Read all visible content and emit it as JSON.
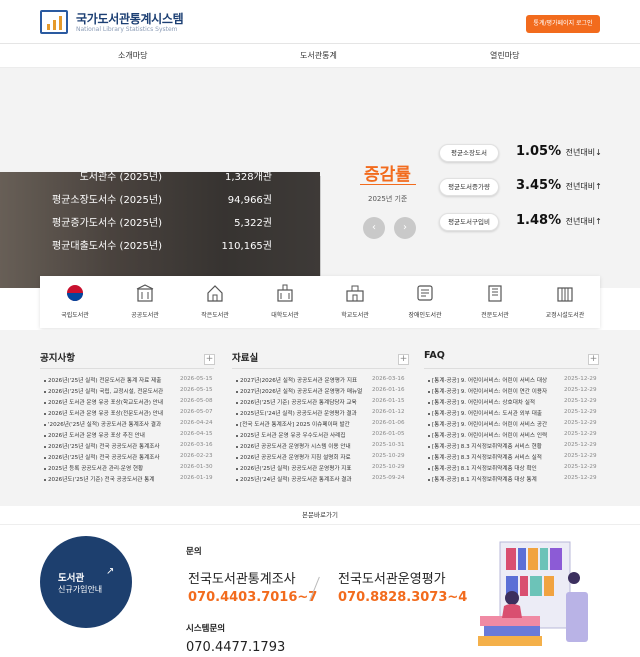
{
  "header": {
    "title": "국가도서관통계시스템",
    "subtitle": "National Library Statistics System",
    "login_button": "통계/평가페이지 로그인"
  },
  "nav": {
    "items": [
      "소개마당",
      "도서관통계",
      "열린마당"
    ]
  },
  "hero": {
    "stats": [
      {
        "label": "도서관수 (2025년)",
        "value": "1,328개관"
      },
      {
        "label": "평균소장도서수 (2025년)",
        "value": "94,966권"
      },
      {
        "label": "평균증가도서수 (2025년)",
        "value": "5,322권"
      },
      {
        "label": "평균대출도서수 (2025년)",
        "value": "110,165권"
      }
    ],
    "rate_title": "증감률",
    "rate_year": "2025년 기준",
    "prev_arrow": "‹",
    "next_arrow": "›",
    "rates": [
      {
        "label": "평균소장도서",
        "pct": "1.05%",
        "suffix": "전년대비↓"
      },
      {
        "label": "평균도서증가량",
        "pct": "3.45%",
        "suffix": "전년대비↑"
      },
      {
        "label": "평균도서구입비",
        "pct": "1.48%",
        "suffix": "전년대비↑"
      }
    ]
  },
  "libraries": [
    "국립도서관",
    "공공도서관",
    "작은도서관",
    "대학도서관",
    "학교도서관",
    "장애인도서관",
    "전문도서관",
    "교정시설도서관"
  ],
  "boards": [
    {
      "title": "공지사항",
      "posts": [
        {
          "t": "2026년('25년 실적) 전문도서관 통계 자료 제출",
          "d": "2026-05-15"
        },
        {
          "t": "2026년('25년 실적) 국립, 교정시설, 전문도서관",
          "d": "2026-05-15"
        },
        {
          "t": "2026년 도서관 운영 유공 포상(학교도서관) 안내",
          "d": "2026-05-08"
        },
        {
          "t": "2026년 도서관 운영 유공 포상(전문도서관) 안내",
          "d": "2026-05-07"
        },
        {
          "t": "'2026년('25년 실적) 공공도서관 통계조사 결과",
          "d": "2026-04-24"
        },
        {
          "t": "2026년 도서관 운영 유공 포상 추진 안내",
          "d": "2026-04-15"
        },
        {
          "t": "2026년('25년 실적) 전국 공공도서관 통계조사",
          "d": "2026-03-16"
        },
        {
          "t": "2026년('25년 실적) 전국 공공도서관 통계조사",
          "d": "2026-02-23"
        },
        {
          "t": "2025년 등록 공공도서관 관리·운영 현황",
          "d": "2026-01-30"
        },
        {
          "t": "2026년도('25년 기준) 전국 공공도서관 통계",
          "d": "2026-01-19"
        }
      ]
    },
    {
      "title": "자료실",
      "posts": [
        {
          "t": "2027년(2026년 실적) 공공도서관 운영평가 지표",
          "d": "2026-03-16"
        },
        {
          "t": "2027년(2026년 실적) 공공도서관 운영평가 매뉴얼",
          "d": "2026-01-16"
        },
        {
          "t": "2026년('25년 기준) 공공도서관 통계담당자 교육",
          "d": "2026-01-15"
        },
        {
          "t": "2025년도('24년 실적) 공공도서관 운영평가 결과",
          "d": "2026-01-12"
        },
        {
          "t": "[전국 도서관 통계조사] 2025 이슈페이퍼 발간",
          "d": "2026-01-06"
        },
        {
          "t": "2025년 도서관 운영 유공 우수도서관 사례집",
          "d": "2026-01-05"
        },
        {
          "t": "2026년 공공도서관 운영평가 시스템 이용 안내",
          "d": "2025-10-31"
        },
        {
          "t": "2026년 공공도서관 운영평가 지침 설명회 자료",
          "d": "2025-10-29"
        },
        {
          "t": "2026년('25년 실적) 공공도서관 운영평가 지표",
          "d": "2025-10-29"
        },
        {
          "t": "2025년('24년 실적) 공공도서관 통계조사 결과",
          "d": "2025-09-24"
        }
      ]
    },
    {
      "title": "FAQ",
      "posts": [
        {
          "t": "[통계-공공] 9. 어린이서비스: 어린이 서비스 대상",
          "d": "2025-12-29"
        },
        {
          "t": "[통계-공공] 9. 어린이서비스: 어린이 연간 이용자",
          "d": "2025-12-29"
        },
        {
          "t": "[통계-공공] 9. 어린이서비스: 상호대차 실적",
          "d": "2025-12-29"
        },
        {
          "t": "[통계-공공] 9. 어린이서비스: 도서관 외부 대출",
          "d": "2025-12-29"
        },
        {
          "t": "[통계-공공] 9. 어린이서비스: 어린이 서비스 공간",
          "d": "2025-12-29"
        },
        {
          "t": "[통계-공공] 9. 어린이서비스: 어린이 서비스 인력",
          "d": "2025-12-29"
        },
        {
          "t": "[통계-공공] 8.3 지식정보취약계층 서비스 현황",
          "d": "2025-12-29"
        },
        {
          "t": "[통계-공공] 8.3 지식정보취약계층 서비스 실적",
          "d": "2025-12-29"
        },
        {
          "t": "[통계-공공] 8.1 지식정보취약계층 대상 확인",
          "d": "2025-12-29"
        },
        {
          "t": "[통계-공공] 8.1 지식정보취약계층 대상 통계",
          "d": "2025-12-29"
        }
      ]
    }
  ],
  "skip_link": "본문바로가기",
  "footer": {
    "circle_title": "도서관",
    "circle_sub": "신규가입안내",
    "circle_arrow": "↗",
    "inquiry": "문의",
    "contact1": "전국도서관통계조사",
    "phone1": "070.4403.7016~7",
    "contact2": "전국도서관운영평가",
    "phone2": "070.8828.3073~4",
    "system": "시스템문의",
    "phone3": "070.4477.1793"
  },
  "colors": {
    "accent": "#f26b1d",
    "navy": "#1d3f6e"
  }
}
